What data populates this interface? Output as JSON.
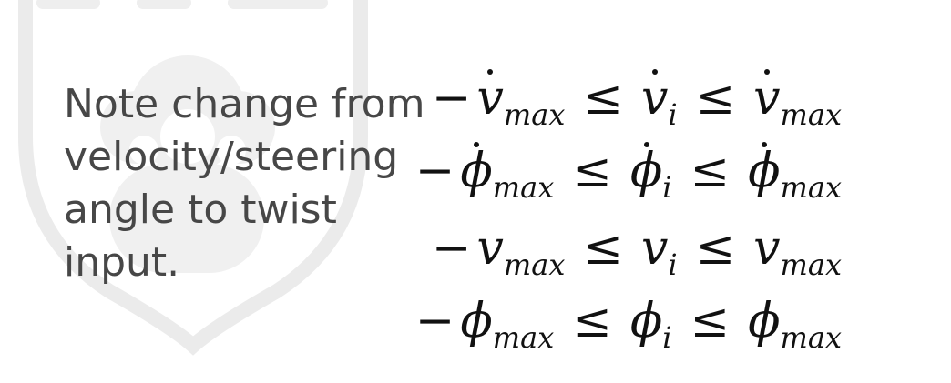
{
  "note": {
    "text": "Note change from\nvelocity/steering\nangle to twist\ninput."
  },
  "watermark": {
    "icon": "shield-crest-icon",
    "color": "#e6e6e6"
  },
  "equations": [
    {
      "leading": "−",
      "left_symbol": "v",
      "left_dot": true,
      "left_sub": "max",
      "op1": "≤",
      "mid_symbol": "v",
      "mid_dot": true,
      "mid_sub": "i",
      "op2": "≤",
      "right_symbol": "v",
      "right_dot": true,
      "right_sub": "max"
    },
    {
      "leading": "−",
      "left_symbol": "ϕ",
      "left_dot": true,
      "left_sub": "max",
      "op1": "≤",
      "mid_symbol": "ϕ",
      "mid_dot": true,
      "mid_sub": "i",
      "op2": "≤",
      "right_symbol": "ϕ",
      "right_dot": true,
      "right_sub": "max"
    },
    {
      "leading": "−",
      "left_symbol": "v",
      "left_dot": false,
      "left_sub": "max",
      "op1": "≤",
      "mid_symbol": "v",
      "mid_dot": false,
      "mid_sub": "i",
      "op2": "≤",
      "right_symbol": "v",
      "right_dot": false,
      "right_sub": "max"
    },
    {
      "leading": "−",
      "left_symbol": "ϕ",
      "left_dot": false,
      "left_sub": "max",
      "op1": "≤",
      "mid_symbol": "ϕ",
      "mid_dot": false,
      "mid_sub": "i",
      "op2": "≤",
      "right_symbol": "ϕ",
      "right_dot": false,
      "right_sub": "max"
    }
  ]
}
